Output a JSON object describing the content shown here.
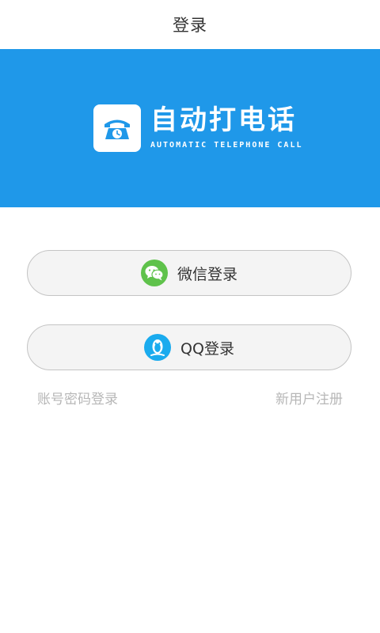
{
  "header": {
    "title": "登录"
  },
  "banner": {
    "app_name": "自动打电话",
    "app_subtitle": "AUTOMATIC TELEPHONE CALL",
    "background_color": "#1f98e9",
    "logo_icon": "telephone-icon"
  },
  "buttons": {
    "wechat": {
      "label": "微信登录",
      "icon": "wechat-icon",
      "icon_color": "#5fc24b"
    },
    "qq": {
      "label": "QQ登录",
      "icon": "qq-penguin-icon",
      "icon_color": "#1aabee"
    }
  },
  "links": {
    "account_login": "账号密码登录",
    "register": "新用户注册"
  }
}
